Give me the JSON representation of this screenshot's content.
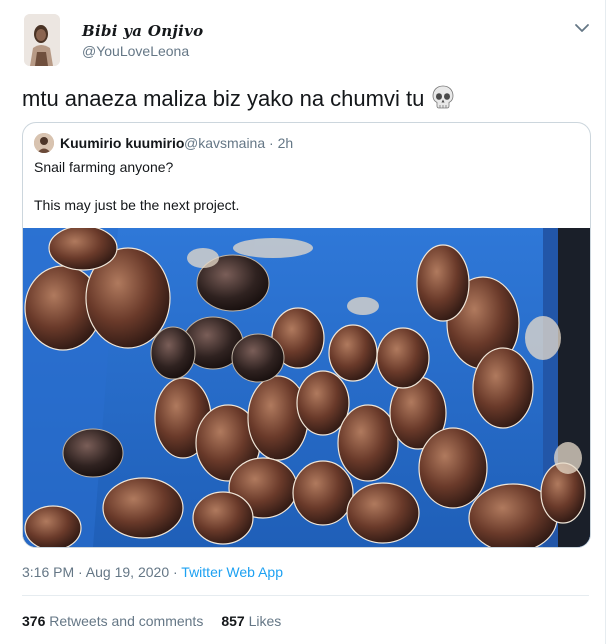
{
  "author": {
    "display_name": "Bibi ya Onjivo",
    "handle": "@YouLoveLeona"
  },
  "tweet": {
    "text": "mtu anaeza maliza biz yako na chumvi tu",
    "emoji": "skull-icon"
  },
  "quoted_tweet": {
    "display_name": "Kuumirio kuumirio",
    "handle_time": "@kavsmaina · 2h",
    "line1": "Snail farming anyone?",
    "line2": "This may just be the next project.",
    "photo": "snails-in-blue-crate-image"
  },
  "meta": {
    "time_date": "3:16 PM · Aug 19, 2020 · ",
    "source": "Twitter Web App"
  },
  "stats": {
    "retweets_count": "376",
    "retweets_label": "Retweets and comments",
    "likes_count": "857",
    "likes_label": "Likes"
  },
  "colors": {
    "accent": "#1da1f2",
    "secondary_text": "#657786",
    "border": "#ccd6dd",
    "crate_blue": "#2a6fd0"
  }
}
